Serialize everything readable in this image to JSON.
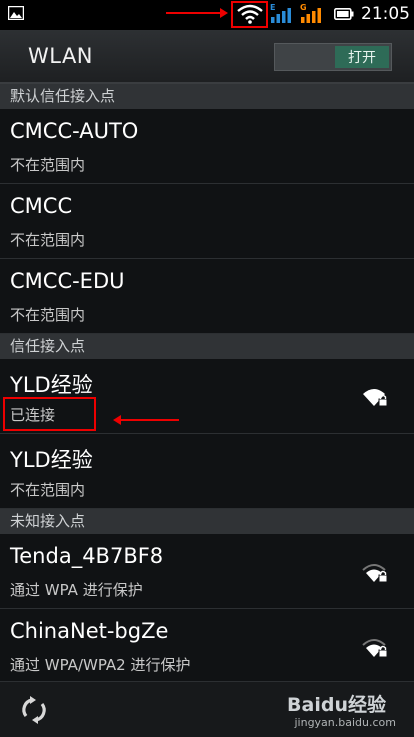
{
  "statusbar": {
    "time": "21:05",
    "sim1_label": "E",
    "sim2_label": "G"
  },
  "header": {
    "title": "WLAN",
    "toggle_label": "打开"
  },
  "sections": [
    {
      "label": "默认信任接入点",
      "networks": [
        {
          "name": "CMCC-AUTO",
          "status": "不在范围内"
        },
        {
          "name": "CMCC",
          "status": "不在范围内"
        },
        {
          "name": "CMCC-EDU",
          "status": "不在范围内"
        }
      ]
    },
    {
      "label": "信任接入点",
      "networks": [
        {
          "name": "YLD经验",
          "status": "已连接",
          "signal_icon": "wifi-lock-icon"
        },
        {
          "name": "YLD经验",
          "status": "不在范围内"
        }
      ]
    },
    {
      "label": "未知接入点",
      "networks": [
        {
          "name": "Tenda_4B7BF8",
          "status": "通过 WPA 进行保护",
          "signal_icon": "wifi-lock-icon"
        },
        {
          "name": "ChinaNet-bgZe",
          "status": "通过 WPA/WPA2 进行保护",
          "signal_icon": "wifi-lock-icon"
        }
      ]
    }
  ],
  "bottombar": {
    "refresh_icon": "refresh-icon",
    "watermark_brand": "Baidu经验",
    "watermark_url": "jingyan.baidu.com"
  },
  "colors": {
    "annotation_red": "#ee0000",
    "toggle_on": "#2e6b57",
    "sim1_color": "#2a8cd8",
    "sim2_color": "#ff8a00"
  }
}
